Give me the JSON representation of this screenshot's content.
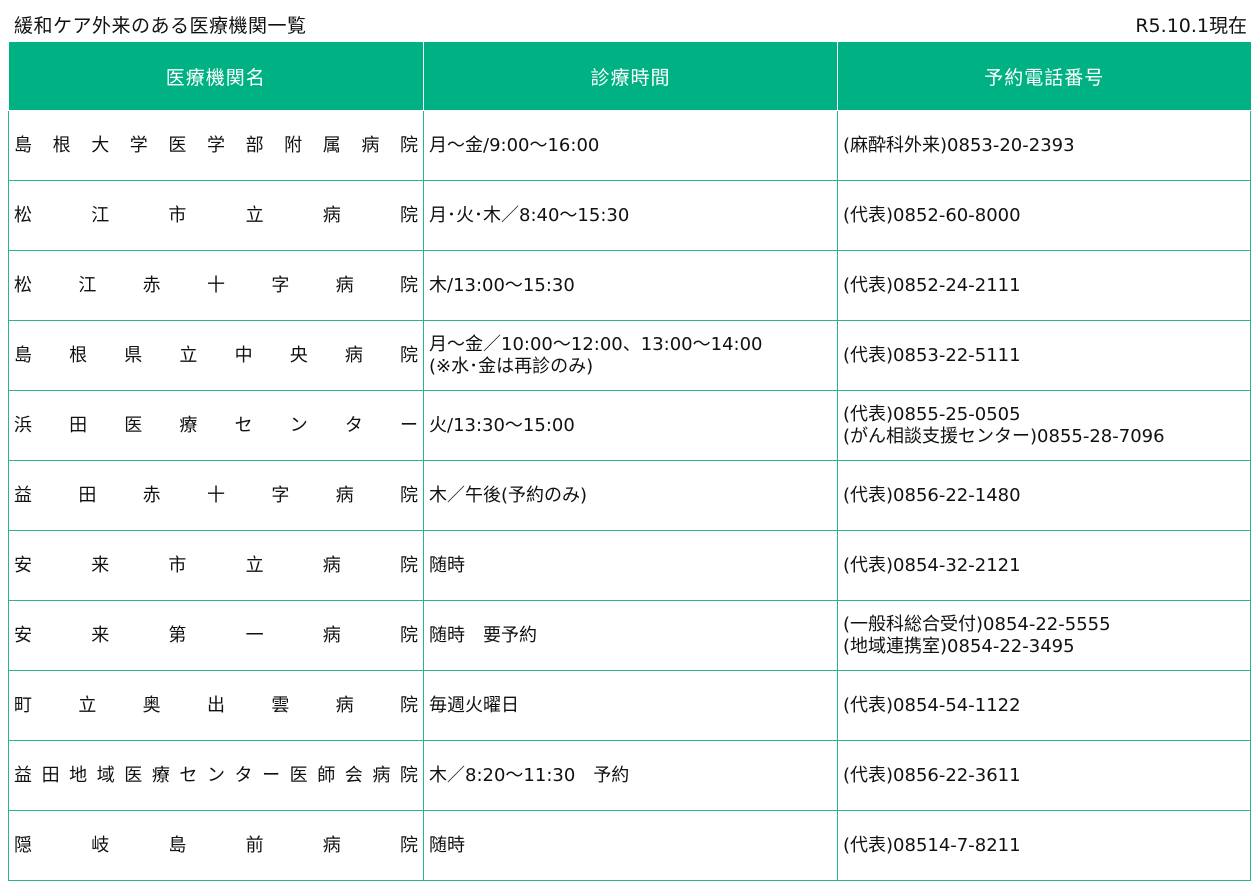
{
  "header": {
    "title": "緩和ケア外来のある医療機関一覧",
    "as_of": "R5.10.1現在"
  },
  "table": {
    "columns": [
      "医療機関名",
      "診療時間",
      "予約電話番号"
    ],
    "rows": [
      {
        "name": "島根大学医学部附属病院",
        "hours": [
          "月～金/9:00～16:00"
        ],
        "phone": [
          "(麻酔科外来)0853-20-2393"
        ]
      },
      {
        "name": "松江市立病院",
        "hours": [
          "月･火･木／8:40～15:30"
        ],
        "phone": [
          "(代表)0852-60-8000"
        ]
      },
      {
        "name": "松江赤十字病院",
        "hours": [
          "木/13:00～15:30"
        ],
        "phone": [
          "(代表)0852-24-2111"
        ]
      },
      {
        "name": "島根県立中央病院",
        "hours": [
          "月～金／10:00～12:00、13:00～14:00",
          "(※水･金は再診のみ)"
        ],
        "phone": [
          "(代表)0853-22-5111"
        ]
      },
      {
        "name": "浜田医療センター",
        "hours": [
          "火/13:30～15:00"
        ],
        "phone": [
          "(代表)0855-25-0505",
          "(がん相談支援センター)0855-28-7096"
        ]
      },
      {
        "name": "益田赤十字病院",
        "hours": [
          "木／午後(予約のみ)"
        ],
        "phone": [
          "(代表)0856-22-1480"
        ]
      },
      {
        "name": "安来市立病院",
        "hours": [
          "随時"
        ],
        "phone": [
          "(代表)0854-32-2121"
        ]
      },
      {
        "name": "安来第一病院",
        "hours": [
          "随時　要予約"
        ],
        "phone": [
          "(一般科総合受付)0854-22-5555",
          "(地域連携室)0854-22-3495"
        ]
      },
      {
        "name": "町立奥出雲病院",
        "hours": [
          "毎週火曜日"
        ],
        "phone": [
          "(代表)0854-54-1122"
        ]
      },
      {
        "name": "益田地域医療センター医師会病院",
        "hours": [
          "木／8:20～11:30　予約"
        ],
        "phone": [
          "(代表)0856-22-3611"
        ]
      },
      {
        "name": "隠岐島前病院",
        "hours": [
          "随時"
        ],
        "phone": [
          "(代表)08514-7-8211"
        ]
      }
    ]
  }
}
